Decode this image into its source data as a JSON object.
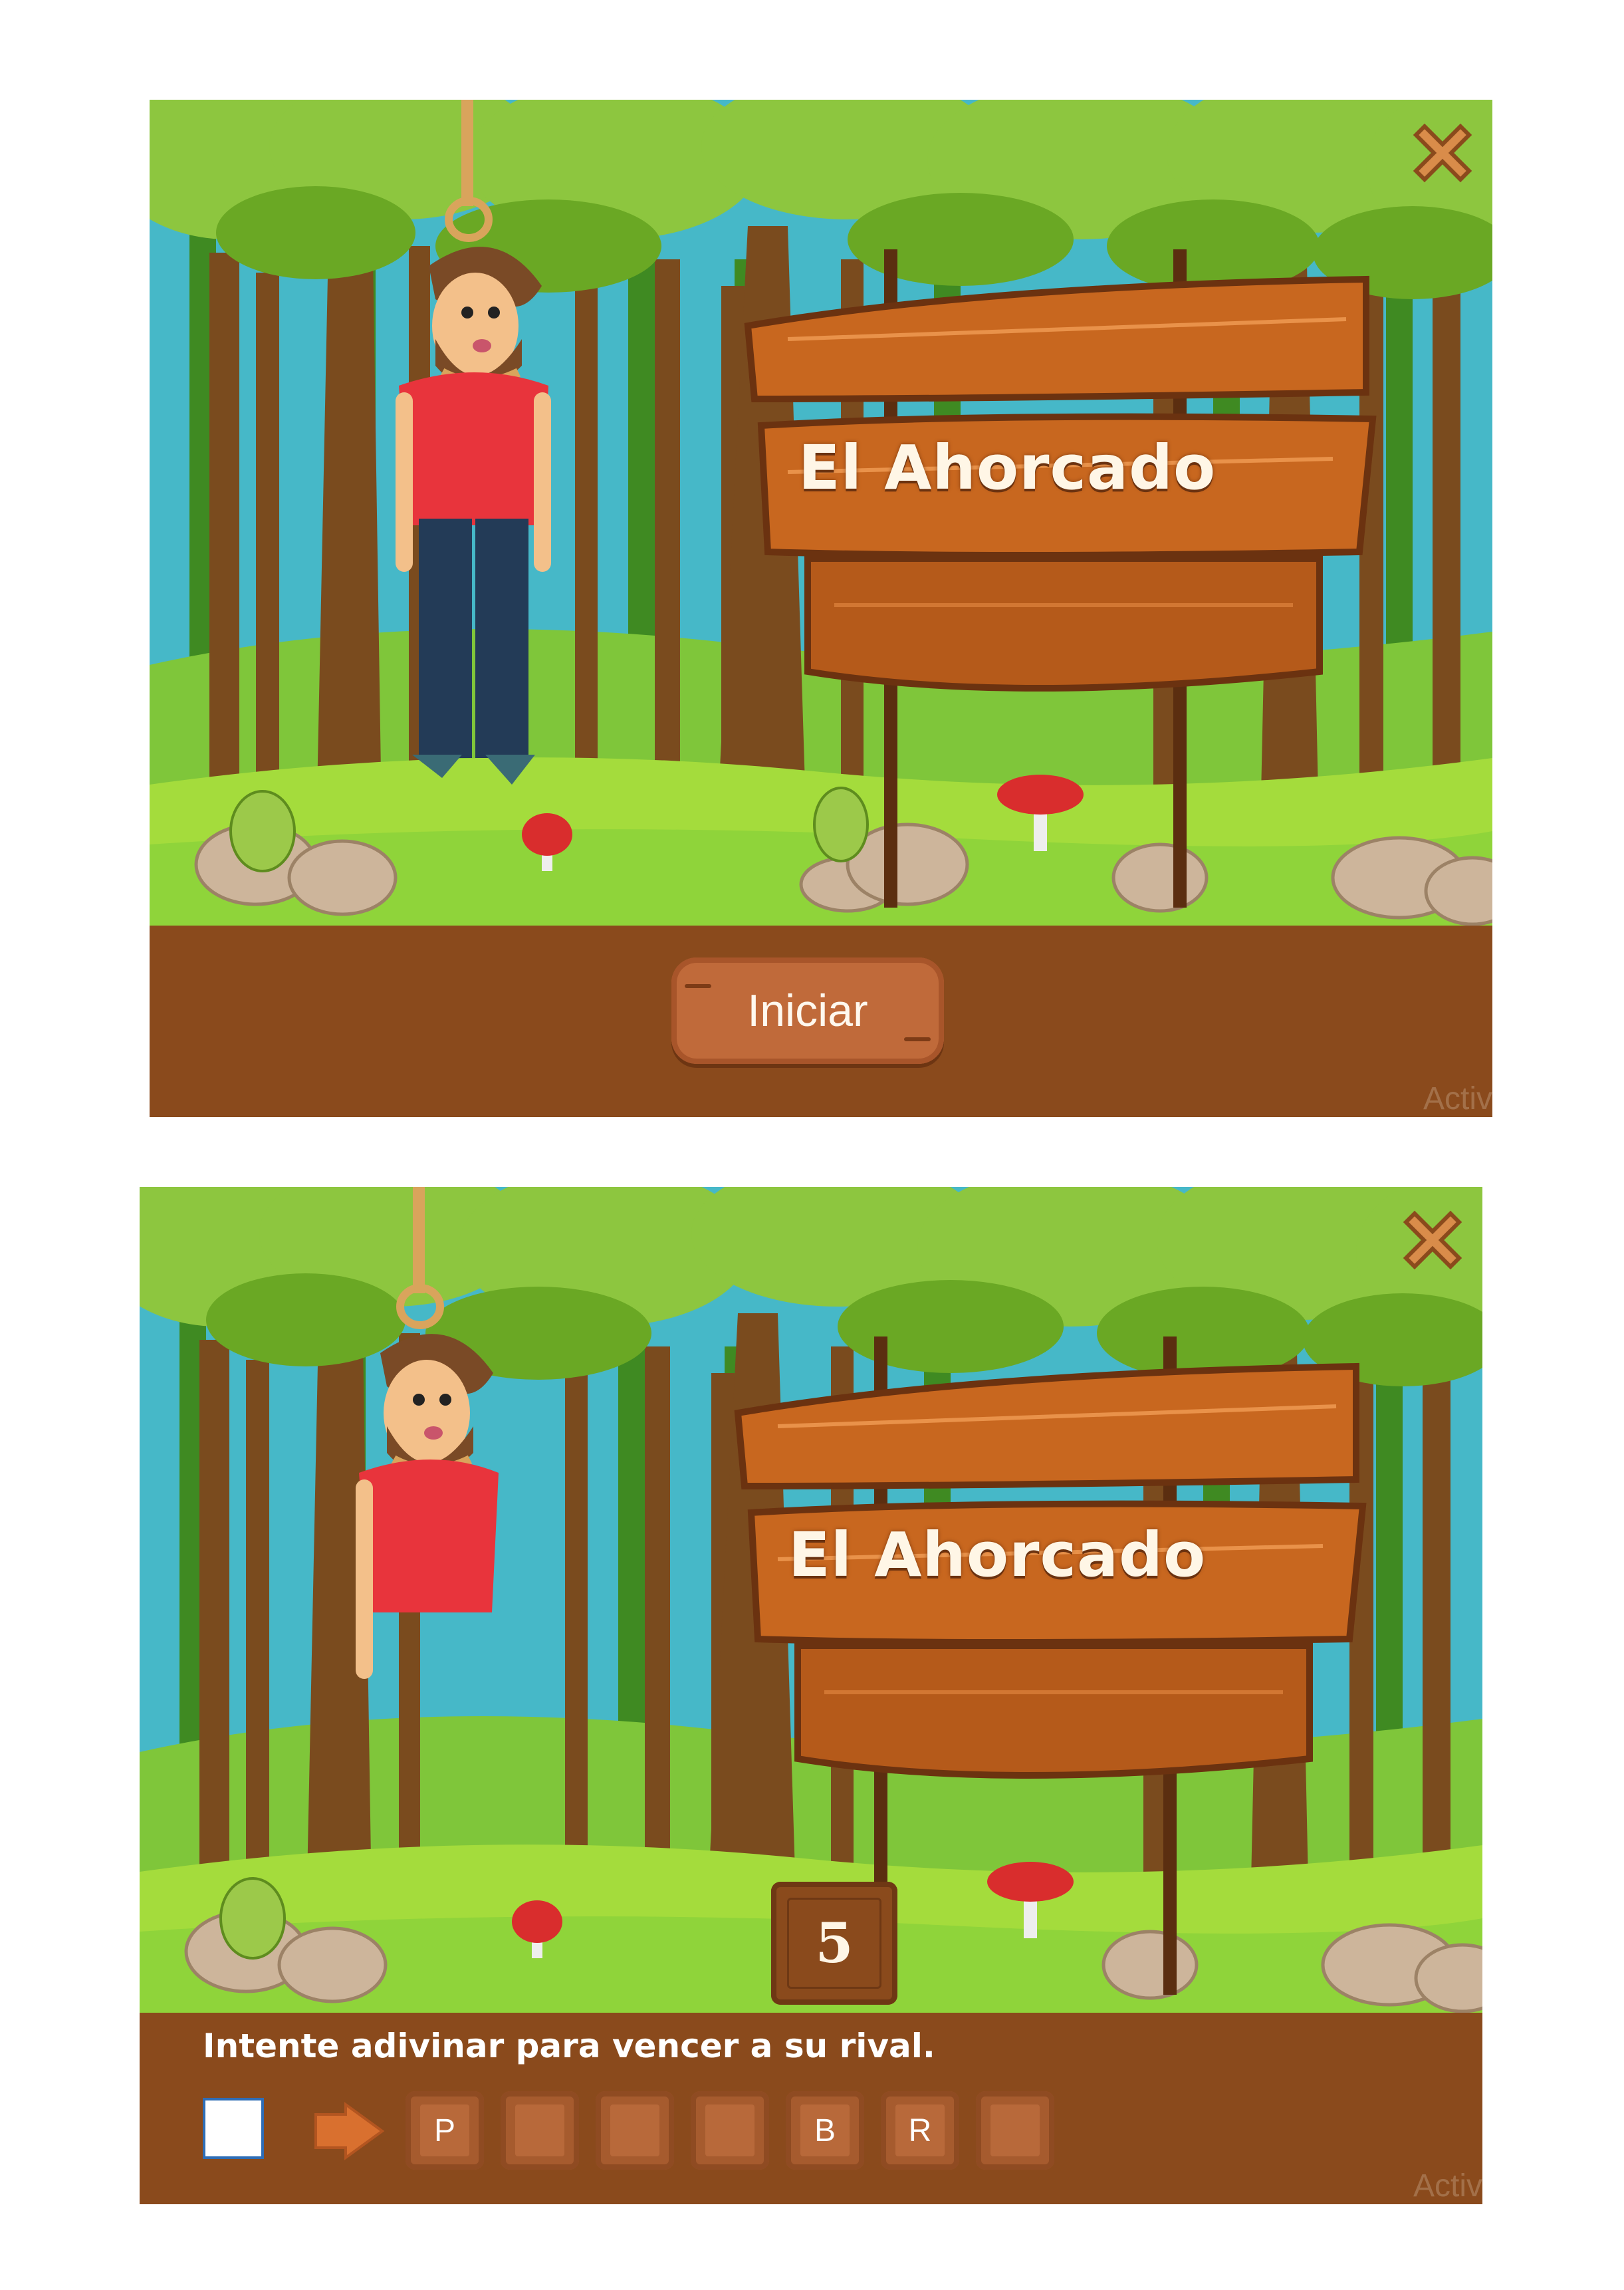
{
  "screens": [
    {
      "title": "El Ahorcado",
      "start_label": "Iniciar",
      "watermark": "Activ"
    },
    {
      "title": "El Ahorcado",
      "counter": "5",
      "hint": "Intente adivinar para vencer a su rival.",
      "answer_value": "",
      "slots": [
        "P",
        "",
        "",
        "",
        "B",
        "R",
        ""
      ],
      "watermark": "Activ"
    }
  ],
  "icons": {
    "close": "close-icon",
    "submit": "arrow-right-icon"
  },
  "colors": {
    "wood": "#8a4a1c",
    "sign": "#c8671f",
    "shirt": "#e8343c",
    "grass": "#8fd43a",
    "foliage": "#79b82b"
  }
}
